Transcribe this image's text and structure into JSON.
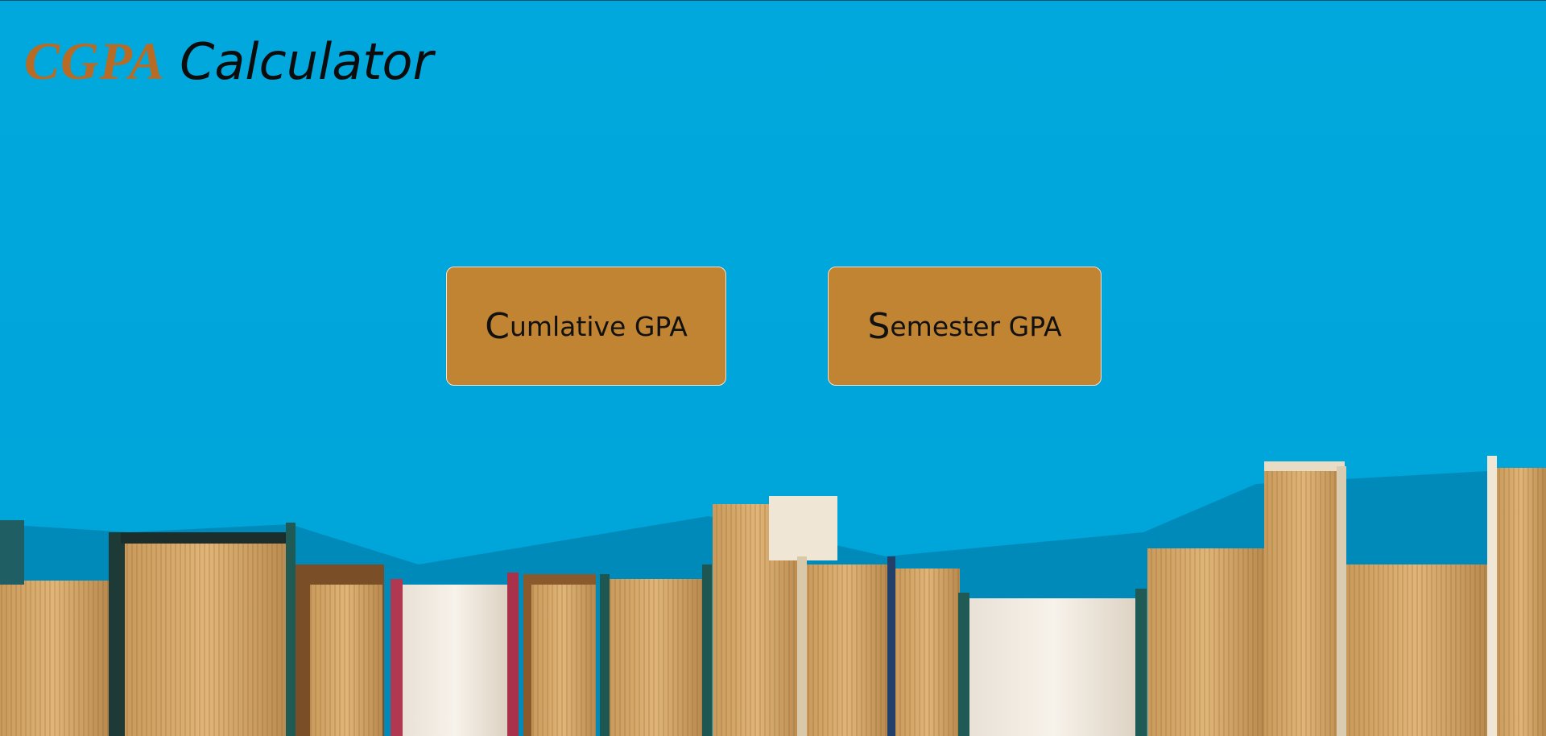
{
  "header": {
    "title_accent": "CGPA",
    "title_main": "Calculator"
  },
  "buttons": {
    "cumulative": {
      "first": "C",
      "rest": "umlative GPA"
    },
    "semester": {
      "first": "S",
      "rest": "emester GPA"
    }
  },
  "colors": {
    "background": "#00a8dd",
    "accent": "#b86b24",
    "button": "#c18432"
  }
}
